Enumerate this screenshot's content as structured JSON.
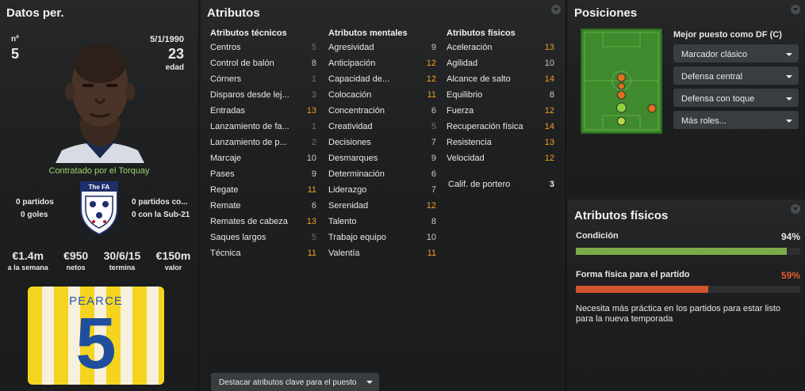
{
  "datos": {
    "title": "Datos per.",
    "number_label": "nº",
    "number": "5",
    "dob": "5/1/1990",
    "age": "23",
    "age_label": "edad",
    "contract": "Contratado por el Torquay",
    "badge_text": "The FA",
    "left_stats": [
      "0 partidos",
      "0 goles"
    ],
    "right_stats": [
      "0 partidos co...",
      "0 con la Sub-21"
    ],
    "finance": [
      {
        "value": "€1.4m",
        "label": "a la semana"
      },
      {
        "value": "€950",
        "label": "netos"
      },
      {
        "value": "30/6/15",
        "label": "termina"
      },
      {
        "value": "€150m",
        "label": "valor"
      }
    ],
    "shirt_name": "PEARCE",
    "shirt_number": "5"
  },
  "atributos": {
    "title": "Atributos",
    "tecnicos_head": "Atributos técnicos",
    "mentales_head": "Atributos mentales",
    "fisicos_head": "Atributos físicos",
    "tecnicos": [
      {
        "name": "Centros",
        "value": "5"
      },
      {
        "name": "Control de balón",
        "value": "8"
      },
      {
        "name": "Córners",
        "value": "1"
      },
      {
        "name": "Disparos desde lej...",
        "value": "3"
      },
      {
        "name": "Entradas",
        "value": "13"
      },
      {
        "name": "Lanzamiento de fa...",
        "value": "1"
      },
      {
        "name": "Lanzamiento de p...",
        "value": "2"
      },
      {
        "name": "Marcaje",
        "value": "10"
      },
      {
        "name": "Pases",
        "value": "9"
      },
      {
        "name": "Regate",
        "value": "11"
      },
      {
        "name": "Remate",
        "value": "6"
      },
      {
        "name": "Remates de cabeza",
        "value": "13"
      },
      {
        "name": "Saques largos",
        "value": "5"
      },
      {
        "name": "Técnica",
        "value": "11"
      }
    ],
    "mentales": [
      {
        "name": "Agresividad",
        "value": "9"
      },
      {
        "name": "Anticipación",
        "value": "12"
      },
      {
        "name": "Capacidad de...",
        "value": "12"
      },
      {
        "name": "Colocación",
        "value": "11"
      },
      {
        "name": "Concentración",
        "value": "6"
      },
      {
        "name": "Creatividad",
        "value": "5"
      },
      {
        "name": "Decisiones",
        "value": "7"
      },
      {
        "name": "Desmarques",
        "value": "9"
      },
      {
        "name": "Determinación",
        "value": "6"
      },
      {
        "name": "Liderazgo",
        "value": "7"
      },
      {
        "name": "Serenidad",
        "value": "12"
      },
      {
        "name": "Talento",
        "value": "8"
      },
      {
        "name": "Trabajo equipo",
        "value": "10"
      },
      {
        "name": "Valentía",
        "value": "11"
      }
    ],
    "fisicos": [
      {
        "name": "Aceleración",
        "value": "13"
      },
      {
        "name": "Agilidad",
        "value": "10"
      },
      {
        "name": "Alcance de salto",
        "value": "14"
      },
      {
        "name": "Equilibrio",
        "value": "8"
      },
      {
        "name": "Fuerza",
        "value": "12"
      },
      {
        "name": "Recuperación física",
        "value": "14"
      },
      {
        "name": "Resistencia",
        "value": "13"
      },
      {
        "name": "Velocidad",
        "value": "12"
      }
    ],
    "portero": {
      "name": "Calif. de portero",
      "value": "3"
    },
    "highlight_button": "Destacar atributos clave para el puesto"
  },
  "posiciones": {
    "title": "Posiciones",
    "best": "Mejor puesto como DF (C)",
    "roles": [
      "Marcador clásico",
      "Defensa central",
      "Defensa con toque",
      "Más roles..."
    ]
  },
  "fisicos": {
    "title": "Atributos físicos",
    "condicion_label": "Condición",
    "condicion_value": "94%",
    "condicion_fraction": 0.94,
    "forma_label": "Forma física para el partido",
    "forma_value": "59%",
    "forma_fraction": 0.59,
    "note": "Necesita más práctica en los partidos para estar listo para la nueva temporada",
    "colors": {
      "condicion": "#79ab4a",
      "forma": "#d2542e",
      "forma_text": "#e55a35"
    }
  }
}
